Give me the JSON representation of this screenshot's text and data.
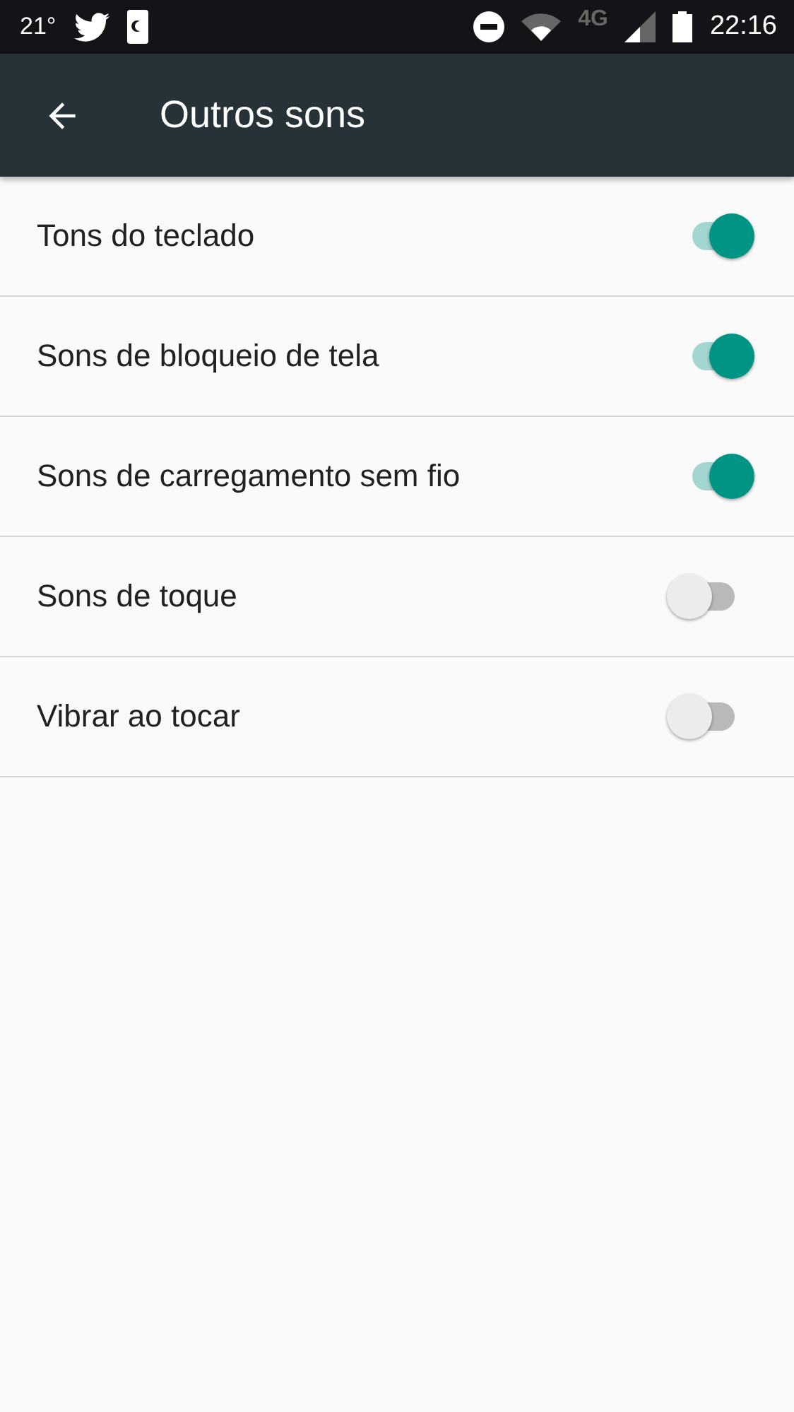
{
  "status_bar": {
    "temperature": "21°",
    "network": "4G",
    "time": "22:16"
  },
  "app_bar": {
    "title": "Outros sons"
  },
  "settings": [
    {
      "label": "Tons do teclado",
      "on": true
    },
    {
      "label": "Sons de bloqueio de tela",
      "on": true
    },
    {
      "label": "Sons de carregamento sem fio",
      "on": true
    },
    {
      "label": "Sons de toque",
      "on": false
    },
    {
      "label": "Vibrar ao tocar",
      "on": false
    }
  ]
}
